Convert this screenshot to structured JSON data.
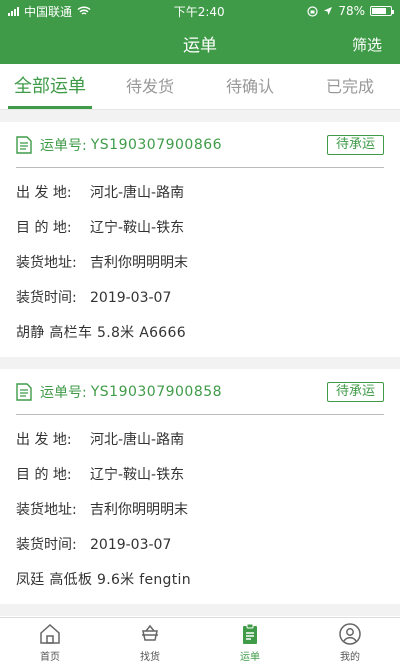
{
  "status_bar": {
    "carrier": "中国联通",
    "time": "下午2:40",
    "battery": "78%",
    "battery_level": 0.78
  },
  "header": {
    "title": "运单",
    "filter_label": "筛选"
  },
  "tabs": [
    {
      "label": "全部运单",
      "active": true
    },
    {
      "label": "待发货",
      "active": false
    },
    {
      "label": "待确认",
      "active": false
    },
    {
      "label": "已完成",
      "active": false
    }
  ],
  "orders": [
    {
      "order_label": "运单号:",
      "order_no": "YS190307900866",
      "status": "待承运",
      "origin_label": "出 发 地:",
      "origin": "河北-唐山-路南",
      "dest_label": "目 的 地:",
      "dest": "辽宁-鞍山-铁东",
      "address_label": "装货地址:",
      "address": "吉利你明明明末",
      "time_label": "装货时间:",
      "time": "2019-03-07",
      "driver_info": "胡静 高栏车 5.8米 A6666"
    },
    {
      "order_label": "运单号:",
      "order_no": "YS190307900858",
      "status": "待承运",
      "origin_label": "出 发 地:",
      "origin": "河北-唐山-路南",
      "dest_label": "目 的 地:",
      "dest": "辽宁-鞍山-铁东",
      "address_label": "装货地址:",
      "address": "吉利你明明明末",
      "time_label": "装货时间:",
      "time": "2019-03-07",
      "driver_info": "凤廷 高低板 9.6米 fengtin"
    }
  ],
  "tabbar": [
    {
      "label": "首页",
      "icon": "home-icon",
      "active": false
    },
    {
      "label": "找货",
      "icon": "cargo-icon",
      "active": false
    },
    {
      "label": "运单",
      "icon": "waybill-icon",
      "active": true
    },
    {
      "label": "我的",
      "icon": "profile-icon",
      "active": false
    }
  ],
  "colors": {
    "brand": "#3f9b48",
    "text": "#333333",
    "muted": "#999999"
  }
}
